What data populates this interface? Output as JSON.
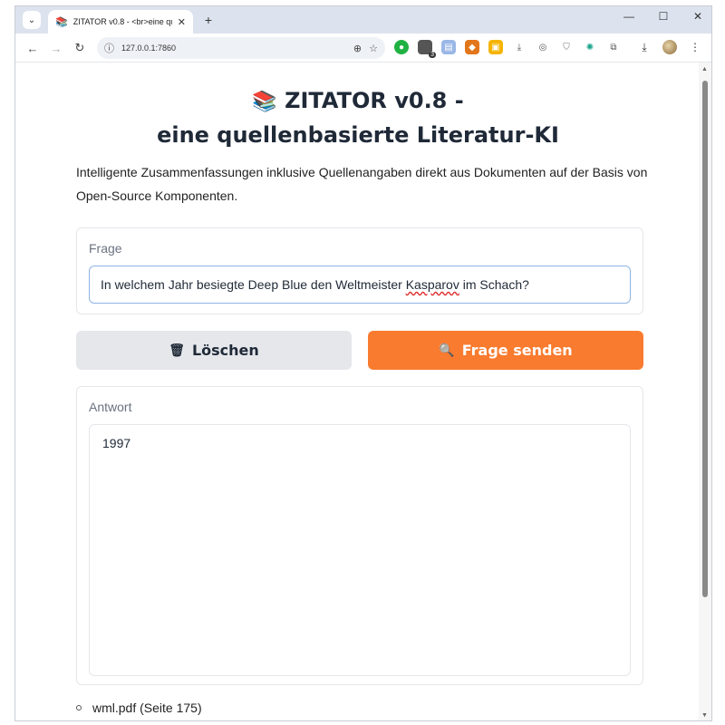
{
  "browser": {
    "tab_title": "ZITATOR v0.8 - <br>eine qu",
    "url": "127.0.0.1:7860",
    "extension_badge": "3"
  },
  "page": {
    "title_line1": "ZITATOR v0.8 -",
    "title_line2": "eine quellenbasierte Literatur-KI",
    "intro": "Intelligente Zusammenfassungen inklusive Quellenangaben direkt aus Dokumenten auf der Basis von Open-Source Komponenten.",
    "question": {
      "label": "Frage",
      "value_before": "In welchem Jahr besiegte Deep Blue den Weltmeister ",
      "value_misspelled": "Kasparov",
      "value_after": " im Schach?"
    },
    "clear_button": "Löschen",
    "send_button": "Frage senden",
    "answer": {
      "label": "Antwort",
      "value": "1997"
    },
    "sources": [
      "wml.pdf (Seite 175)"
    ]
  },
  "colors": {
    "accent": "#f97b2f",
    "secondary_button": "#e5e7eb"
  }
}
